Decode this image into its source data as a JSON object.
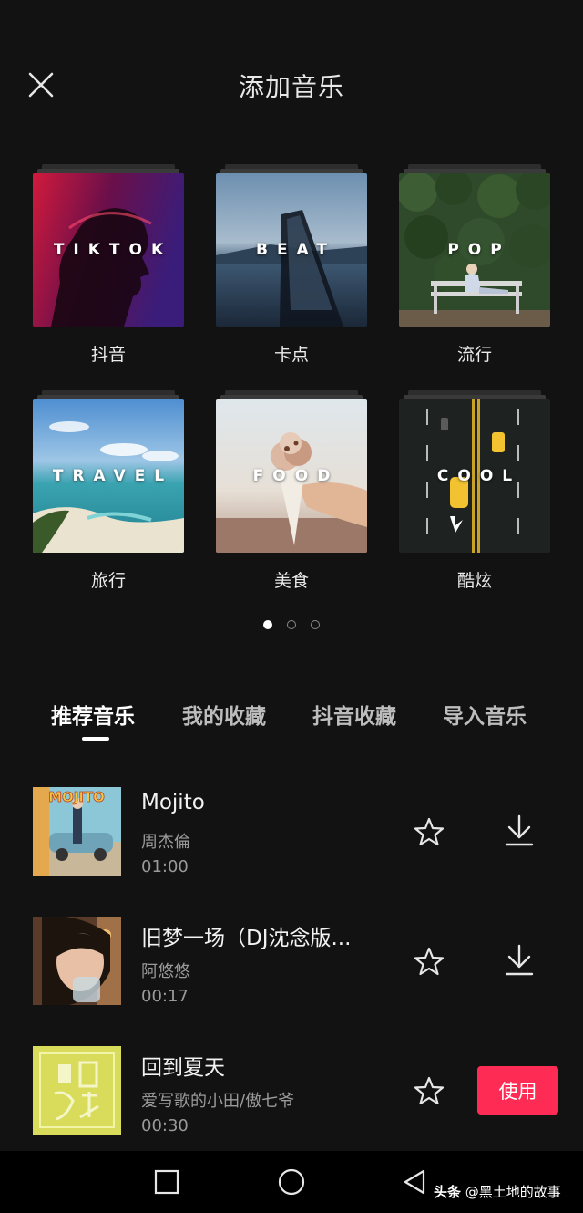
{
  "header": {
    "title": "添加音乐"
  },
  "categories": [
    {
      "label": "抖音",
      "overlay": "TIKTOK"
    },
    {
      "label": "卡点",
      "overlay": "BEAT"
    },
    {
      "label": "流行",
      "overlay": "POP"
    },
    {
      "label": "旅行",
      "overlay": "TRAVEL"
    },
    {
      "label": "美食",
      "overlay": "FOOD"
    },
    {
      "label": "酷炫",
      "overlay": "COOL"
    }
  ],
  "pagination": {
    "pages": 3,
    "current": 1
  },
  "tabs": [
    {
      "label": "推荐音乐",
      "active": true
    },
    {
      "label": "我的收藏",
      "active": false
    },
    {
      "label": "抖音收藏",
      "active": false
    },
    {
      "label": "导入音乐",
      "active": false
    }
  ],
  "songs": [
    {
      "name": "Mojito",
      "artist": "周杰倫",
      "duration": "01:00",
      "cover_text": "MOJITO"
    },
    {
      "name": "旧梦一场（DJ沈念版...",
      "artist": "阿悠悠",
      "duration": "00:17"
    },
    {
      "name": "回到夏天",
      "artist": "爱写歌的小田/傲七爷",
      "duration": "00:30",
      "action_label": "使用"
    }
  ],
  "watermark": {
    "prefix": "头条",
    "text": "@黑土地的故事"
  },
  "colors": {
    "accent": "#fe2c55",
    "background": "#121212"
  },
  "icons": [
    "close-icon",
    "star-icon",
    "download-icon",
    "square-icon",
    "circle-icon",
    "back-triangle-icon"
  ]
}
